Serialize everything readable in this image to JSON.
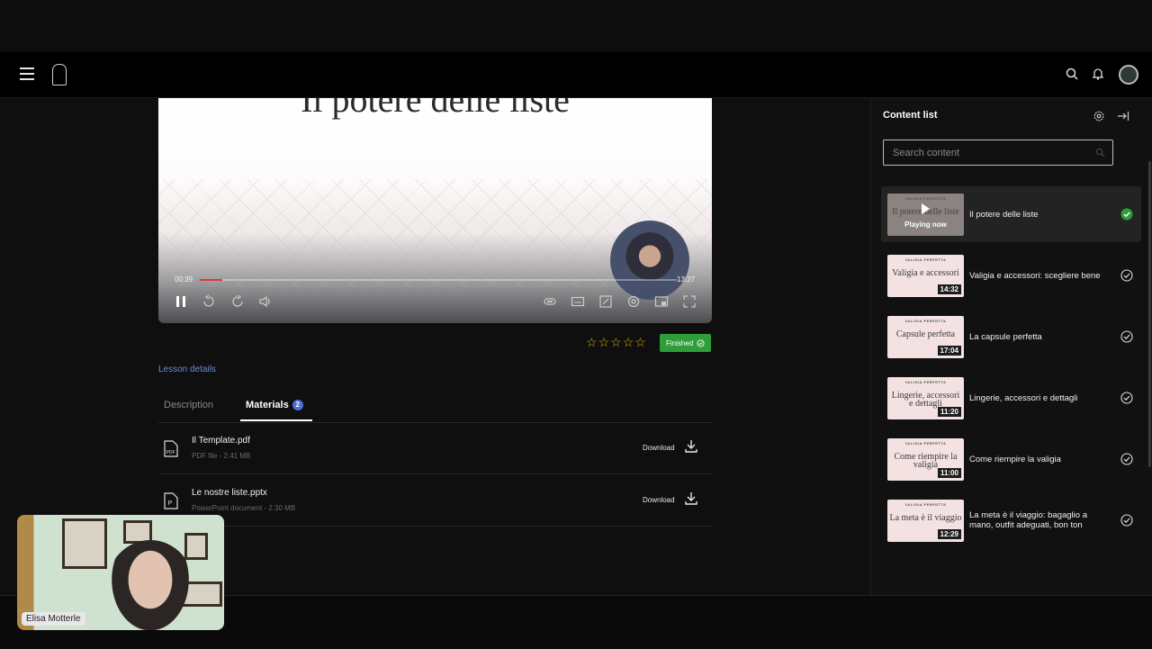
{
  "video": {
    "slide_title": "Il potere delle liste",
    "current_time": "00:39",
    "duration": "13:27",
    "progress": 0.048
  },
  "rating": {
    "stars": 5,
    "filled": 0
  },
  "status_badge": "Finished",
  "lesson_details_label": "Lesson details",
  "tabs": [
    {
      "label": "Description"
    },
    {
      "label": "Materials",
      "count": "2"
    }
  ],
  "materials": [
    {
      "name": "Il Template.pdf",
      "meta": "PDF file - 2.41 MB",
      "download_label": "Download",
      "icon": "pdf-icon"
    },
    {
      "name": "Le nostre liste.pptx",
      "meta": "PowerPoint document - 2.30 MB",
      "download_label": "Download",
      "icon": "pptx-icon"
    }
  ],
  "webcam": {
    "name": "Elisa Motterle"
  },
  "content_panel": {
    "title": "Content list",
    "search_placeholder": "Search content",
    "items": [
      {
        "thumb_brand": "VALIGIA PERFETTA",
        "thumb_title": "Il potere delle liste",
        "overlay": "Playing now",
        "label": "Il potere delle liste",
        "completed": true,
        "active": true
      },
      {
        "thumb_brand": "VALIGIA PERFETTA",
        "thumb_title": "Valigia e accessori",
        "duration": "14:32",
        "label": "Valigia e accessori: scegliere bene",
        "completed": false
      },
      {
        "thumb_brand": "VALIGIA PERFETTA",
        "thumb_title": "Capsule perfetta",
        "duration": "17:04",
        "label": "La capsule perfetta",
        "completed": false
      },
      {
        "thumb_brand": "VALIGIA PERFETTA",
        "thumb_title": "Lingerie, accessori e dettagli",
        "duration": "11:20",
        "label": "Lingerie, accessori e dettagli",
        "completed": false
      },
      {
        "thumb_brand": "VALIGIA PERFETTA",
        "thumb_title": "Come riempire la valigia",
        "duration": "11:00",
        "label": "Come riempire la valigia",
        "completed": false
      },
      {
        "thumb_brand": "VALIGIA PERFETTA",
        "thumb_title": "La meta è il viaggio",
        "duration": "12:29",
        "label": "La meta è il viaggio: bagaglio a mano, outfit adeguati, bon ton",
        "completed": false
      }
    ]
  },
  "colors": {
    "accent_green": "#2e9e3b",
    "accent_blue": "#6f8ad6",
    "progress_red": "#e53935"
  }
}
